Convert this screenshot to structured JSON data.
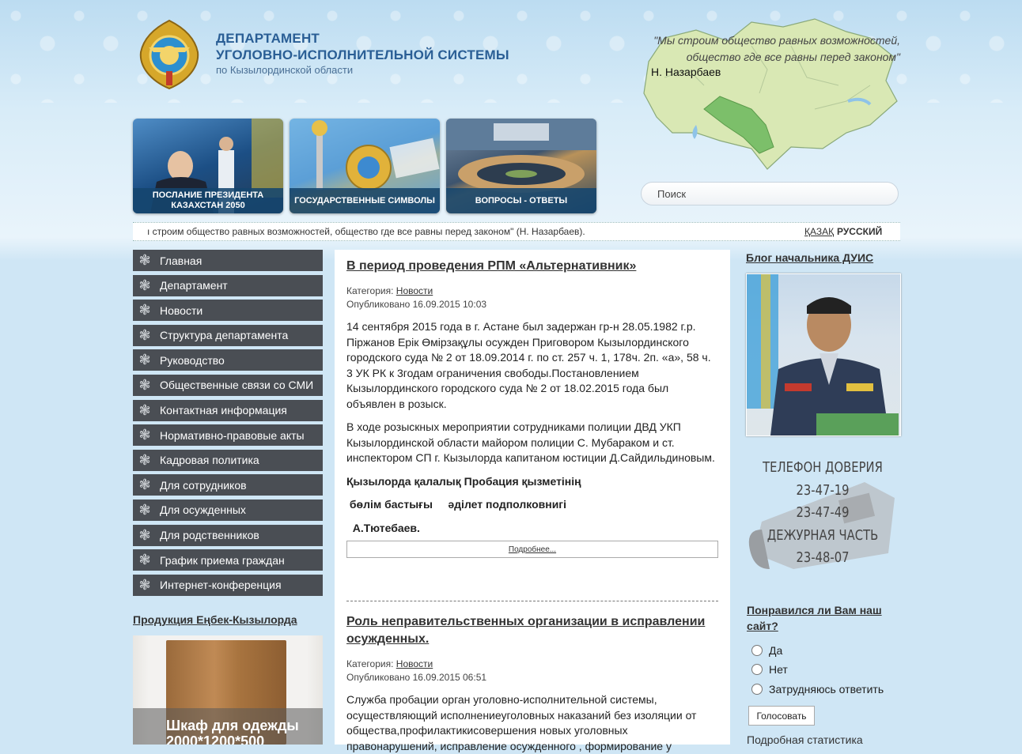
{
  "header": {
    "title_line1": "ДЕПАРТАМЕНТ",
    "title_line2": "УГОЛОВНО-ИСПОЛНИТЕЛЬНОЙ СИСТЕМЫ",
    "subtitle": "по Кызылординской области",
    "quote_line1": "\"Мы строим общество равных возможностей,",
    "quote_line2": "общество где все равны перед законом\"",
    "quote_author": "Н. Назарбаев"
  },
  "banners": [
    {
      "label": "ПОСЛАНИЕ ПРЕЗИДЕНТА КАЗАХСТАН 2050"
    },
    {
      "label": "ГОСУДАРСТВЕННЫЕ СИМВОЛЫ"
    },
    {
      "label": "ВОПРОСЫ - ОТВЕТЫ"
    }
  ],
  "search": {
    "placeholder": "Поиск"
  },
  "ticker": {
    "text": "ı строим общество равных возможностей, общество где все равны перед законом\" (Н. Назарбаев).",
    "lang_kz": "ҚАЗАҚ",
    "lang_ru": "РУССКИЙ"
  },
  "menu": [
    "Главная",
    "Департамент",
    "Новости",
    "Структура департамента",
    "Руководство",
    "Общественные связи со СМИ",
    "Контактная информация",
    "Нормативно-правовые акты",
    "Кадровая политика",
    "Для сотрудников",
    "Для осужденных",
    "Для родственников",
    "График приема граждан",
    "Интернет-конференция"
  ],
  "product": {
    "section_title": "Продукция Еңбек-Кызылорда",
    "name_line1": "Шкаф для одежды",
    "name_line2": "2000*1200*500"
  },
  "articles": [
    {
      "title": "В период проведения РПМ «Альтернативник»",
      "category_label": "Категория:",
      "category": "Новости",
      "published": "Опубликовано 16.09.2015 10:03",
      "p1": "14 сентября 2015 года в г. Астане был задержан гр-н 28.05.1982 г.р. Піржанов Ерік Өмірзақұлы осужден Приговором Кызылординского городского суда № 2 от 18.09.2014 г. по ст. 257 ч. 1, 178ч. 2п. «а», 58 ч. 3 УК РК к 3годам ограничения свободы.Постановлением Кызылординского городского суда № 2 от 18.02.2015 года был объявлен в розыск.",
      "p2": "В ходе розыскных мероприятии сотрудниками полиции ДВД УКП Кызылординской области майором полиции С. Мубараком и ст. инспектором СП г. Кызылорда капитаном юстиции Д.Сайдильдиновым.",
      "sign1": "Қызылорда қалалық Пробация қызметінің",
      "sign2": " бөлім бастығы     әділет подполковнигі",
      "sign3": "  А.Тютебаев.",
      "more": "Подробнее..."
    },
    {
      "title": "Роль неправительственных организации в исправлении осужденных.",
      "category_label": "Категория:",
      "category": "Новости",
      "published": "Опубликовано 16.09.2015 06:51",
      "p1": "Служба пробации орган уголовно-исполнительной системы, осуществляющий исполнениеуголовных наказаний без изоляции от общества,профилактикисовершения новых уголовных правонарушений, исправление осужденного , формирование у"
    }
  ],
  "blog": {
    "title": "Блог начальника ДУИС"
  },
  "trust_phone": {
    "line1": "ТЕЛЕФОН ДОВЕРИЯ",
    "line2": "23-47-19",
    "line3": "23-47-49",
    "line4": "ДЕЖУРНАЯ ЧАСТЬ",
    "line5": "23-48-07"
  },
  "poll": {
    "question": "Понравился ли Вам наш сайт?",
    "options": [
      "Да",
      "Нет",
      "Затрудняюсь ответить"
    ],
    "vote_label": "Голосовать",
    "stats_label": "Подробная статистика"
  },
  "colors": {
    "menu_bg": "#4a4e54",
    "title_blue": "#2a5e95",
    "banner_caption": "#14466e"
  }
}
